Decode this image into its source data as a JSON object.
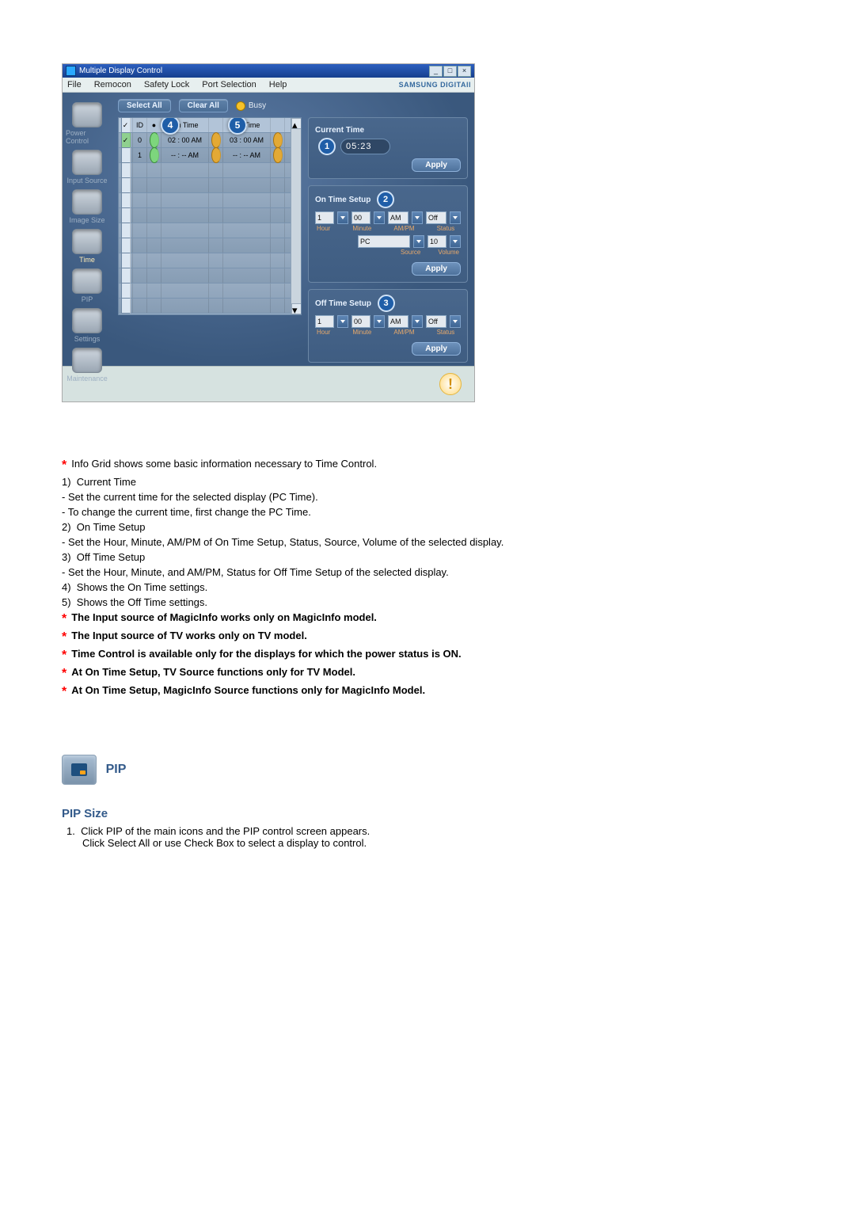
{
  "app": {
    "title": "Multiple Display Control",
    "menu": [
      "File",
      "Remocon",
      "Safety Lock",
      "Port Selection",
      "Help"
    ],
    "brand": "SAMSUNG DIGITAll"
  },
  "sidebar": {
    "items": [
      {
        "label": "Power Control"
      },
      {
        "label": "Input Source"
      },
      {
        "label": "Image Size"
      },
      {
        "label": "Time"
      },
      {
        "label": "PIP"
      },
      {
        "label": "Settings"
      },
      {
        "label": "Maintenance"
      }
    ]
  },
  "toolbar": {
    "select_all": "Select All",
    "clear_all": "Clear All",
    "busy": "Busy"
  },
  "grid": {
    "headers": [
      "",
      "ID",
      "",
      "On Time",
      "",
      "Off Time",
      ""
    ],
    "rows": [
      {
        "checked": true,
        "id": "0",
        "on_time": "02 : 00 AM",
        "off_time": "03 : 00 AM"
      },
      {
        "checked": false,
        "id": "1",
        "on_time": "-- : -- AM",
        "off_time": "-- : -- AM"
      }
    ],
    "badge4": "4",
    "badge5": "5"
  },
  "current_time": {
    "title": "Current Time",
    "badge": "1",
    "value": "05:23",
    "apply": "Apply"
  },
  "on_time": {
    "title": "On Time Setup",
    "badge": "2",
    "hour": "1",
    "minute": "00",
    "ampm": "AM",
    "status": "Off",
    "labels": [
      "Hour",
      "Minute",
      "AM/PM",
      "Status"
    ],
    "source": "PC",
    "volume": "10",
    "labels2": [
      "Source",
      "Volume"
    ],
    "apply": "Apply"
  },
  "off_time": {
    "title": "Off Time Setup",
    "badge": "3",
    "hour": "1",
    "minute": "00",
    "ampm": "AM",
    "status": "Off",
    "labels": [
      "Hour",
      "Minute",
      "AM/PM",
      "Status"
    ],
    "apply": "Apply"
  },
  "doc": {
    "star_info": "Info Grid shows some basic information necessary to Time Control.",
    "n1": "Current Time",
    "n1a": "- Set the current time for the selected display (PC Time).",
    "n1b": "- To change the current time, first change the PC Time.",
    "n2": "On Time Setup",
    "n2a": "- Set the Hour, Minute, AM/PM of On Time Setup, Status, Source, Volume of the selected display.",
    "n3": "Off Time Setup",
    "n3a": "- Set the Hour, Minute, and AM/PM, Status for Off Time Setup of the selected display.",
    "n4": "Shows the On Time settings.",
    "n5": "Shows the Off Time settings.",
    "b1": "The Input source of MagicInfo works only on MagicInfo model.",
    "b2": "The Input source of TV works only on TV model.",
    "b3": "Time Control is available only for the displays for which the power status is ON.",
    "b4": "At On Time Setup, TV Source functions only for TV Model.",
    "b5": "At On Time Setup, MagicInfo Source functions only for MagicInfo Model.",
    "pip": "PIP",
    "pipsize": "PIP Size",
    "pipsize1": "Click PIP of the main icons and the PIP control screen appears.",
    "pipsize2": "Click Select All or use Check Box to select a display to control."
  }
}
